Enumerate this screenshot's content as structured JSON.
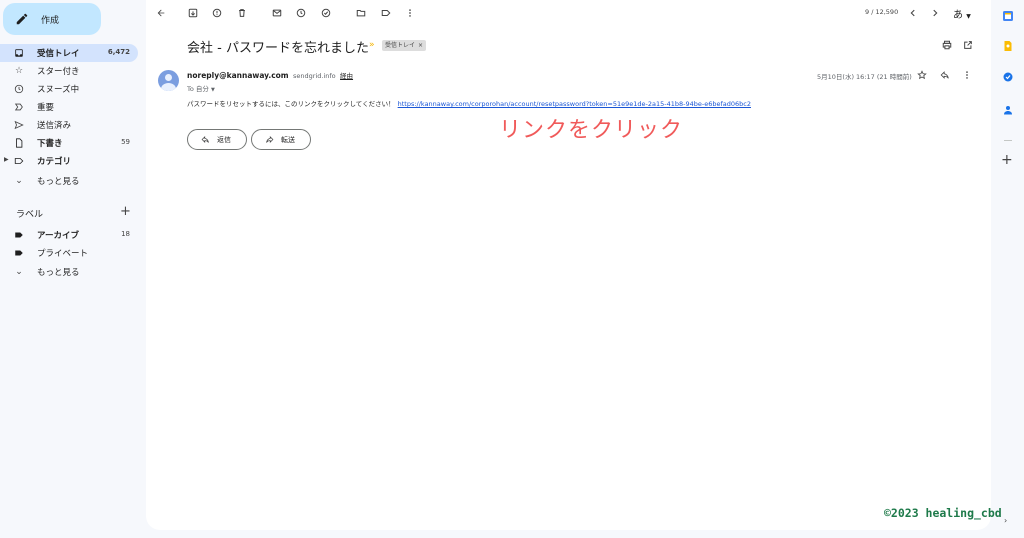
{
  "compose": {
    "label": "作成"
  },
  "sidebar": {
    "items": [
      {
        "label": "受信トレイ",
        "count": "6,472"
      },
      {
        "label": "スター付き",
        "count": ""
      },
      {
        "label": "スヌーズ中",
        "count": ""
      },
      {
        "label": "重要",
        "count": ""
      },
      {
        "label": "送信済み",
        "count": ""
      },
      {
        "label": "下書き",
        "count": "59"
      },
      {
        "label": "カテゴリ",
        "count": ""
      },
      {
        "label": "もっと見る",
        "count": ""
      }
    ],
    "labels_heading": "ラベル",
    "labels": [
      {
        "label": "アーカイブ",
        "count": "18"
      },
      {
        "label": "プライベート",
        "count": ""
      },
      {
        "label": "もっと見る",
        "count": ""
      }
    ]
  },
  "toolbar": {
    "page_count": "9 / 12,590",
    "input_lang": "あ"
  },
  "email": {
    "subject": "会社 - パスワードを忘れました",
    "inbox_chip": "受信トレイ",
    "chip_close": "×",
    "sender_email": "noreply@kannaway.com",
    "via_domain": "sendgrid.info",
    "via_label": "経由",
    "to_line": "To 自分",
    "date": "5月10日(水) 16:17 (21 時間前)",
    "body": "パスワードをリセットするには、このリンクをクリックしてください！",
    "link": "https://kannaway.com/corporohan/account/resetpassword?token=51e9e1de-2a15-41b8-94be-e6befad06bc2"
  },
  "annotation": "リンクをクリック",
  "actions": {
    "reply": "返信",
    "forward": "転送"
  },
  "watermark": "©2023 healing_cbd",
  "colors": {
    "accent": "#c2e7ff",
    "active_nav": "#d3e3fd",
    "link": "#1a56d6",
    "annotation": "#f05a5a",
    "watermark": "#1e7a4a"
  }
}
